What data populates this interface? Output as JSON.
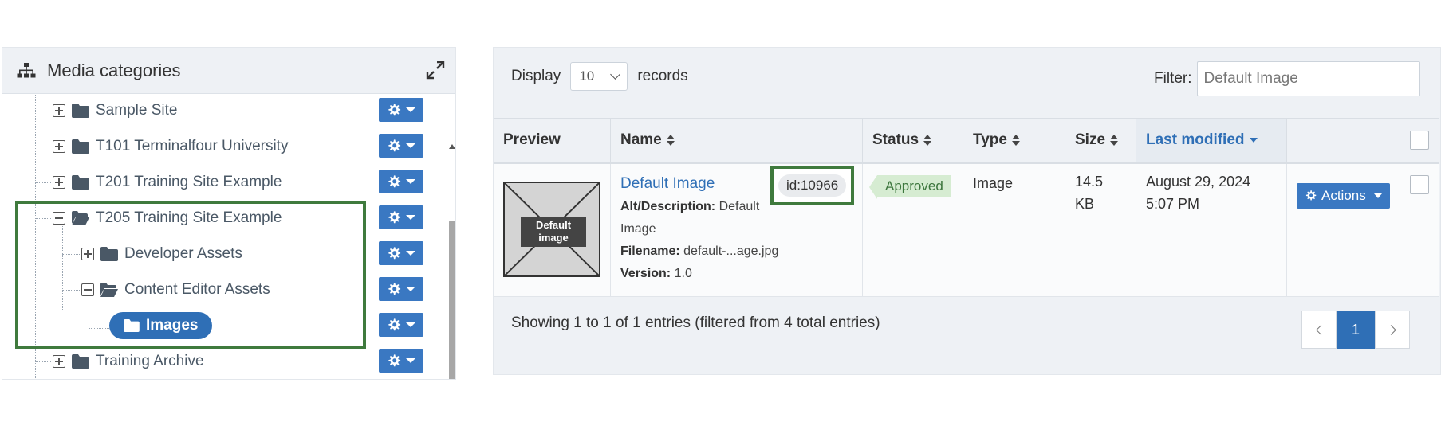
{
  "panel": {
    "title": "Media categories",
    "icons": {
      "header": "sitemap-icon",
      "expand": "expand-icon",
      "gear": "gear-icon",
      "folder": "folder-icon",
      "folder_open": "folder-open-icon"
    }
  },
  "tree": {
    "items": [
      {
        "label": "Sample Site",
        "state": "collapsed"
      },
      {
        "label": "T101 Terminalfour University",
        "state": "collapsed"
      },
      {
        "label": "T201 Training Site Example",
        "state": "collapsed"
      },
      {
        "label": "T205 Training Site Example",
        "state": "expanded"
      },
      {
        "label": "Developer Assets",
        "state": "collapsed"
      },
      {
        "label": "Content Editor Assets",
        "state": "expanded"
      },
      {
        "label": "Images",
        "state": "selected"
      },
      {
        "label": "Training Archive",
        "state": "collapsed"
      }
    ]
  },
  "toolbar": {
    "display_label": "Display",
    "records_value": "10",
    "records_label": "records",
    "filter_label": "Filter:",
    "filter_placeholder": "Default Image"
  },
  "table": {
    "headers": [
      "Preview",
      "Name",
      "Status",
      "Type",
      "Size",
      "Last modified"
    ],
    "sorted_column": "Last modified",
    "rows": [
      {
        "thumbnail_text_1": "Default",
        "thumbnail_text_2": "image",
        "name": "Default Image",
        "id": "id:10966",
        "alt_label": "Alt/Description:",
        "alt_value_1": "Default",
        "alt_value_2": "Image",
        "filename_label": "Filename:",
        "filename_value": "default-...age.jpg",
        "version_label": "Version:",
        "version_value": "1.0",
        "status": "Approved",
        "type": "Image",
        "size_1": "14.5",
        "size_2": "KB",
        "modified_date": "August 29, 2024",
        "modified_time": "5:07 PM",
        "actions_label": "Actions"
      }
    ]
  },
  "footer": {
    "showing_text": "Showing 1 to 1 of 1 entries (filtered from 4 total entries)",
    "current_page": "1"
  },
  "colors": {
    "primary": "#3a78c2",
    "highlight_border": "#3f7a3d",
    "status_approved_bg": "#d6ecd2",
    "status_approved_text": "#3c763d"
  }
}
